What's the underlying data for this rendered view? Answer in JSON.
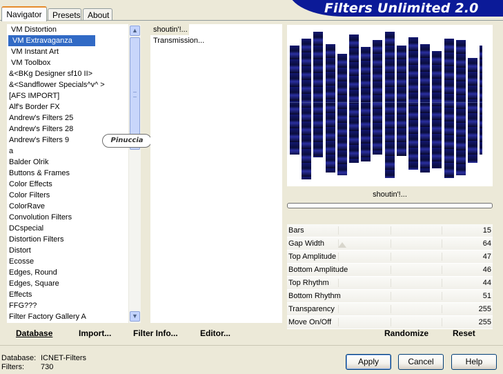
{
  "app": {
    "title": "Filters Unlimited 2.0"
  },
  "tabs": [
    {
      "label": "Navigator",
      "active": true
    },
    {
      "label": "Presets",
      "active": false
    },
    {
      "label": "About",
      "active": false
    }
  ],
  "filter_list": {
    "selected": "VM Extravaganza",
    "items": [
      "VM Distortion",
      "VM Extravaganza",
      "VM Instant Art",
      "VM Toolbox",
      "&<BKg Designer sf10 II>",
      "&<Sandflower Specials^v^ >",
      "[AFS IMPORT]",
      "Alf's Border FX",
      "Andrew's Filters 25",
      "Andrew's Filters 28",
      "Andrew's Filters 9",
      "a",
      "Balder Olrik",
      "Buttons & Frames",
      "Color Effects",
      "Color Filters",
      "ColorRave",
      "Convolution Filters",
      "DCspecial",
      "Distortion Filters",
      "Distort",
      "Ecosse",
      "Edges, Round",
      "Edges, Square",
      "Effects",
      "FFG???",
      "Filter Factory Gallery A"
    ]
  },
  "effect_list": {
    "items": [
      "shoutin'!...",
      "Transmission..."
    ],
    "selected": "shoutin'!..."
  },
  "preview": {
    "preset_name": "shoutin'!...",
    "bar_colors": {
      "dark": "#0a0d3c",
      "mid": "#131870",
      "light": "#2a2fa0"
    }
  },
  "params": [
    {
      "name": "Bars",
      "value": "15"
    },
    {
      "name": "Gap Width",
      "value": "64"
    },
    {
      "name": "Top Amplitude",
      "value": "47"
    },
    {
      "name": "Bottom Amplitude",
      "value": "46"
    },
    {
      "name": "Top Rhythm",
      "value": "44"
    },
    {
      "name": "Bottom Rhythm",
      "value": "51"
    },
    {
      "name": "Transparency",
      "value": "255"
    },
    {
      "name": "Move On/Off",
      "value": "255"
    }
  ],
  "bottom_links": {
    "database": "Database",
    "import": "Import...",
    "filter_info": "Filter Info...",
    "editor": "Editor...",
    "randomize": "Randomize",
    "reset": "Reset"
  },
  "db_info": {
    "database_label": "Database:",
    "database_value": "ICNET-Filters",
    "filters_label": "Filters:",
    "filters_value": "730"
  },
  "buttons": {
    "apply": "Apply",
    "cancel": "Cancel",
    "help": "Help"
  },
  "watermark": "Pinuccia",
  "icons": {
    "scroll_up": "chevron-up-icon",
    "scroll_down": "chevron-down-icon"
  },
  "colors": {
    "banner": "#0b1a98",
    "selection": "#316ac5",
    "panel": "#ece9d8"
  }
}
